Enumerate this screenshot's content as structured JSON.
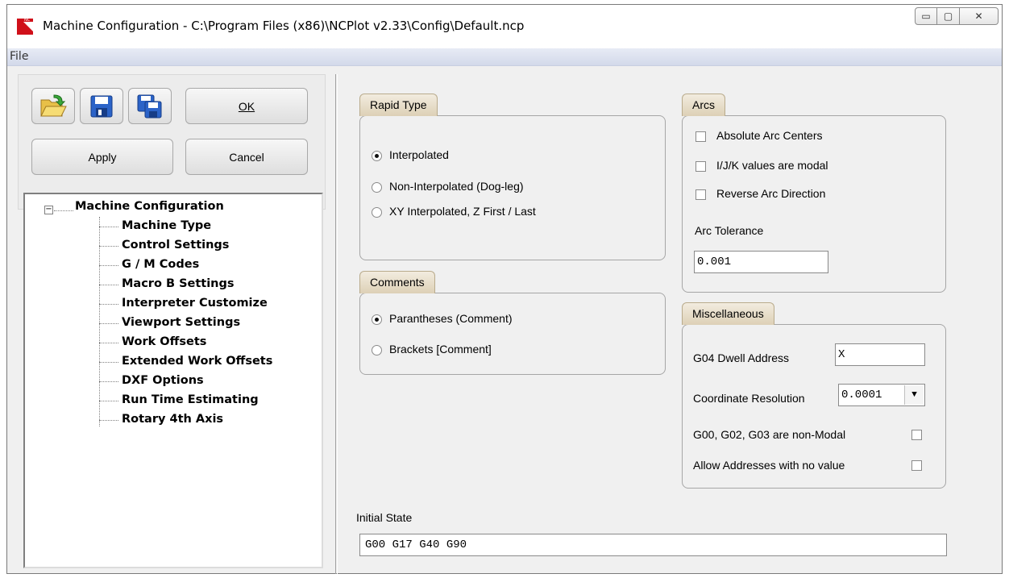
{
  "window": {
    "title": "Machine Configuration - C:\\Program Files (x86)\\NCPlot v2.33\\Config\\Default.ncp",
    "min_glyph": "▭",
    "max_glyph": "▢",
    "close_glyph": "✕"
  },
  "menu": {
    "file": "File"
  },
  "toolbar": {
    "open_icon": "folder-open-icon",
    "save_icon": "save-icon",
    "save_as_icon": "save-as-icon",
    "ok_label": "OK",
    "apply_label": "Apply",
    "cancel_label": "Cancel"
  },
  "tree": {
    "root": "Machine Configuration",
    "expander": "−",
    "items": [
      "Machine Type",
      "Control Settings",
      "G / M Codes",
      "Macro B Settings",
      "Interpreter Customize",
      "Viewport Settings",
      "Work Offsets",
      "Extended Work Offsets",
      "DXF Options",
      "Run Time Estimating",
      "Rotary 4th Axis"
    ]
  },
  "rapid_type": {
    "title": "Rapid Type",
    "options": [
      "Interpolated",
      "Non-Interpolated (Dog-leg)",
      "XY Interpolated, Z First / Last"
    ],
    "selected": 0
  },
  "comments": {
    "title": "Comments",
    "options": [
      "Parantheses  (Comment)",
      "Brackets  [Comment]"
    ],
    "selected": 0
  },
  "arcs": {
    "title": "Arcs",
    "checks": [
      "Absolute Arc Centers",
      "I/J/K values are modal",
      "Reverse Arc Direction"
    ],
    "tolerance_label": "Arc Tolerance",
    "tolerance_value": "0.001"
  },
  "misc": {
    "title": "Miscellaneous",
    "dwell_label": "G04 Dwell Address",
    "dwell_value": "X",
    "resolution_label": "Coordinate Resolution",
    "resolution_value": "0.0001",
    "nonmodal_label": "G00, G02, G03 are non-Modal",
    "noval_label": "Allow Addresses with no value"
  },
  "initial_state": {
    "label": "Initial State",
    "value": "G00 G17 G40 G90"
  }
}
